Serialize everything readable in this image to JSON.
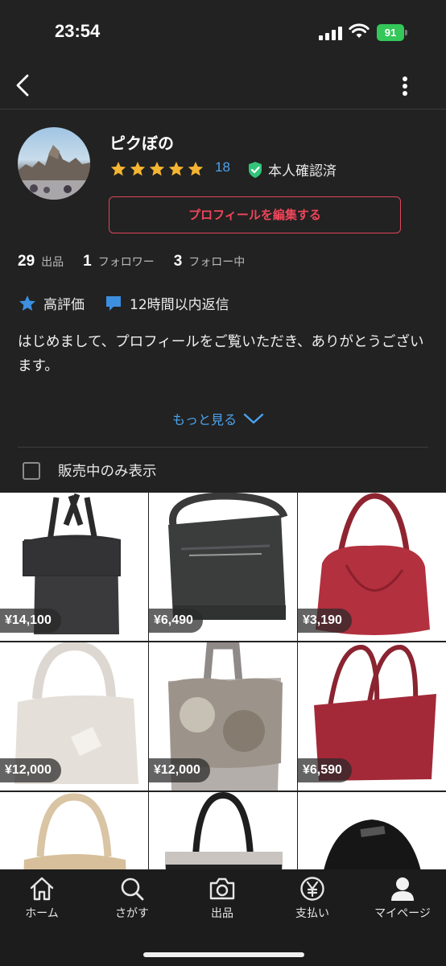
{
  "status_bar": {
    "time": "23:54",
    "battery": "91"
  },
  "profile": {
    "name": "ピクぼの",
    "rating_stars": 5,
    "rating_count": "18",
    "verified_label": "本人確認済",
    "edit_button": "プロフィールを編集する",
    "stats": [
      {
        "value": "29",
        "label": "出品"
      },
      {
        "value": "1",
        "label": "フォロワー"
      },
      {
        "value": "3",
        "label": "フォロー中"
      }
    ],
    "badges": [
      {
        "icon": "star-icon",
        "label": "高評価"
      },
      {
        "icon": "chat-bubble-icon",
        "label": "12時間以内返信"
      }
    ],
    "bio": "はじめまして、プロフィールをご覧いただき、ありがとうございます。",
    "more_link": "もっと見る"
  },
  "filter": {
    "label": "販売中のみ表示",
    "checked": false
  },
  "items": [
    {
      "price": "¥14,100"
    },
    {
      "price": "¥6,490"
    },
    {
      "price": "¥3,190"
    },
    {
      "price": "¥12,000"
    },
    {
      "price": "¥12,000"
    },
    {
      "price": "¥6,590"
    },
    {
      "price": ""
    },
    {
      "price": ""
    },
    {
      "price": ""
    }
  ],
  "tab_bar": {
    "tabs": [
      {
        "icon": "home-icon",
        "label": "ホーム"
      },
      {
        "icon": "search-icon",
        "label": "さがす"
      },
      {
        "icon": "camera-icon",
        "label": "出品"
      },
      {
        "icon": "yen-icon",
        "label": "支払い"
      },
      {
        "icon": "person-icon",
        "label": "マイページ"
      }
    ]
  },
  "colors": {
    "background": "#222222",
    "accent_red": "#f0455a",
    "link_blue": "#4aa3f0",
    "star_yellow": "#f5b531",
    "verified_green": "#33c47a"
  }
}
